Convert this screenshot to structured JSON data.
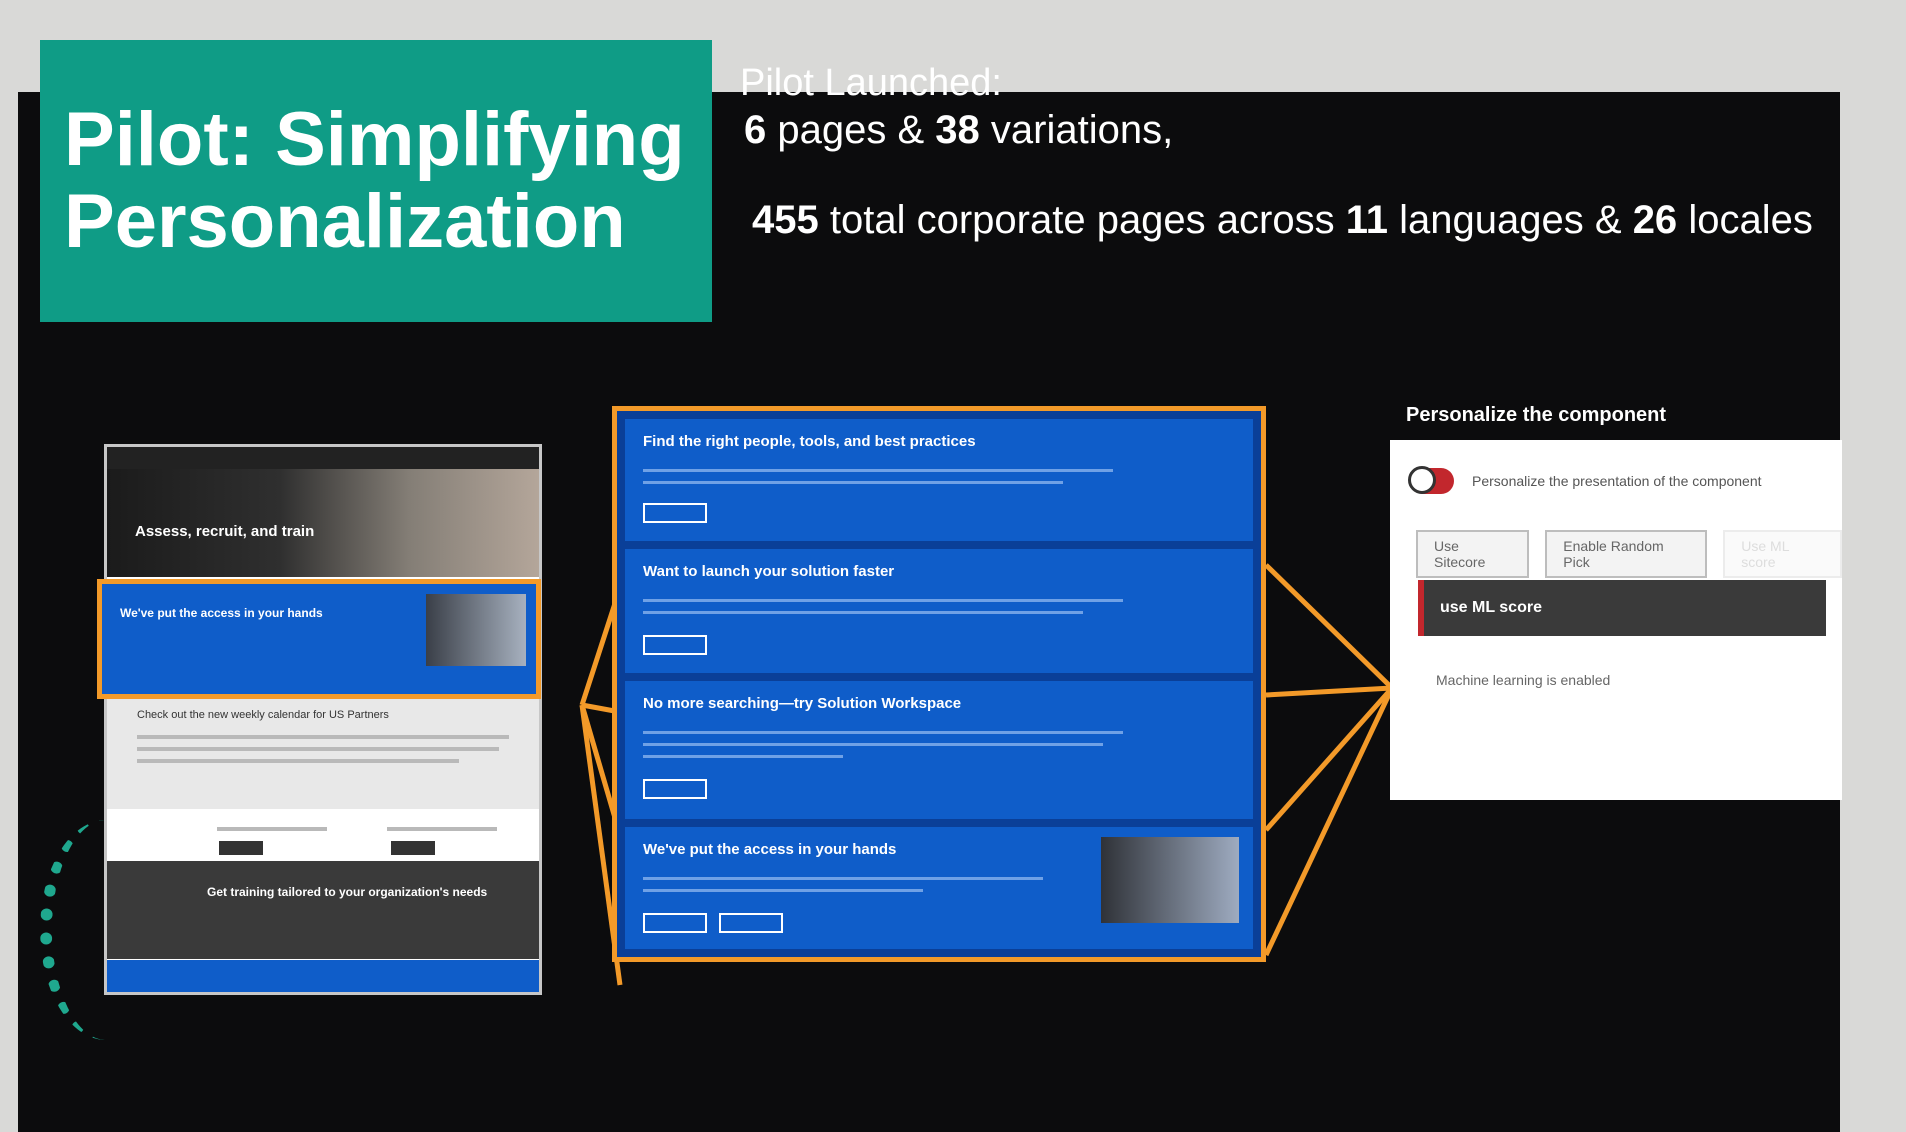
{
  "slide": {
    "title_line1": "Pilot: Simplifying",
    "title_line2": "Personalization",
    "launched_label": "Pilot Launched:",
    "pages_count": "6",
    "pages_text": "pages &",
    "variations_count": "38",
    "variations_text": "variations,",
    "total_pages": "455",
    "total_text": "total corporate pages across",
    "languages_count": "11",
    "languages_text": "languages &",
    "locales_count": "26",
    "locales_text": "locales"
  },
  "left_page": {
    "hero_heading": "Assess, recruit, and train",
    "highlight_heading": "We've put the access in your hands",
    "section_heading": "Check out the new weekly calendar for US Partners",
    "dark_heading": "Get training tailored to your organization's needs"
  },
  "variations": [
    {
      "heading": "Find the right people, tools, and best practices"
    },
    {
      "heading": "Want to launch your solution faster"
    },
    {
      "heading": "No more searching—try Solution Workspace"
    },
    {
      "heading": "We've put the access in your hands"
    }
  ],
  "personalize": {
    "label": "Personalize the component",
    "toggle_text": "Personalize the presentation of the component",
    "buttons": [
      "Use Sitecore",
      "Enable Random Pick",
      "Use ML score"
    ],
    "selected": "use ML score",
    "status": "Machine learning is enabled"
  },
  "colors": {
    "accent_teal": "#0f9c86",
    "orange": "#f39a29",
    "blue": "#0f5dc9",
    "red": "#c2272d"
  }
}
